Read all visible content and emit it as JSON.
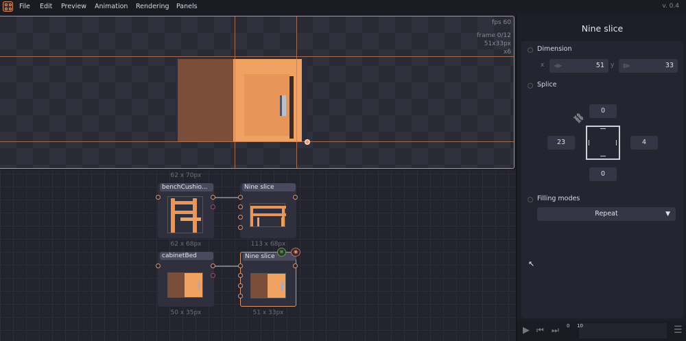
{
  "menu": {
    "items": [
      "File",
      "Edit",
      "Preview",
      "Animation",
      "Rendering",
      "Panels"
    ],
    "version": "v. 0.4"
  },
  "preview": {
    "fps": "fps 60",
    "frame": "frame 0/12",
    "size": "51x33px",
    "scale": "x6"
  },
  "graph": {
    "nodes": [
      {
        "title": "benchCushio...",
        "size_top": "62 x 70px",
        "size": "62 x 68px"
      },
      {
        "title": "Nine slice",
        "size": "113 x 68px"
      },
      {
        "title": "cabinetBed",
        "size": "50 x 35px"
      },
      {
        "title": "Nine slice",
        "size": "51 x 33px"
      }
    ]
  },
  "panel": {
    "title": "Nine slice",
    "dimension": {
      "label": "Dimension",
      "x_label": "x",
      "x": "51",
      "y_label": "y",
      "y": "33"
    },
    "splice": {
      "label": "Splice",
      "top": "0",
      "left": "23",
      "right": "4",
      "bottom": "0"
    },
    "filling": {
      "label": "Filling modes",
      "value": "Repeat"
    },
    "timeline": {
      "marker_start": "0",
      "marker": "10"
    }
  },
  "colors": {
    "accent": "#e0946a",
    "bg": "#1c1c25",
    "panel": "#252531"
  }
}
